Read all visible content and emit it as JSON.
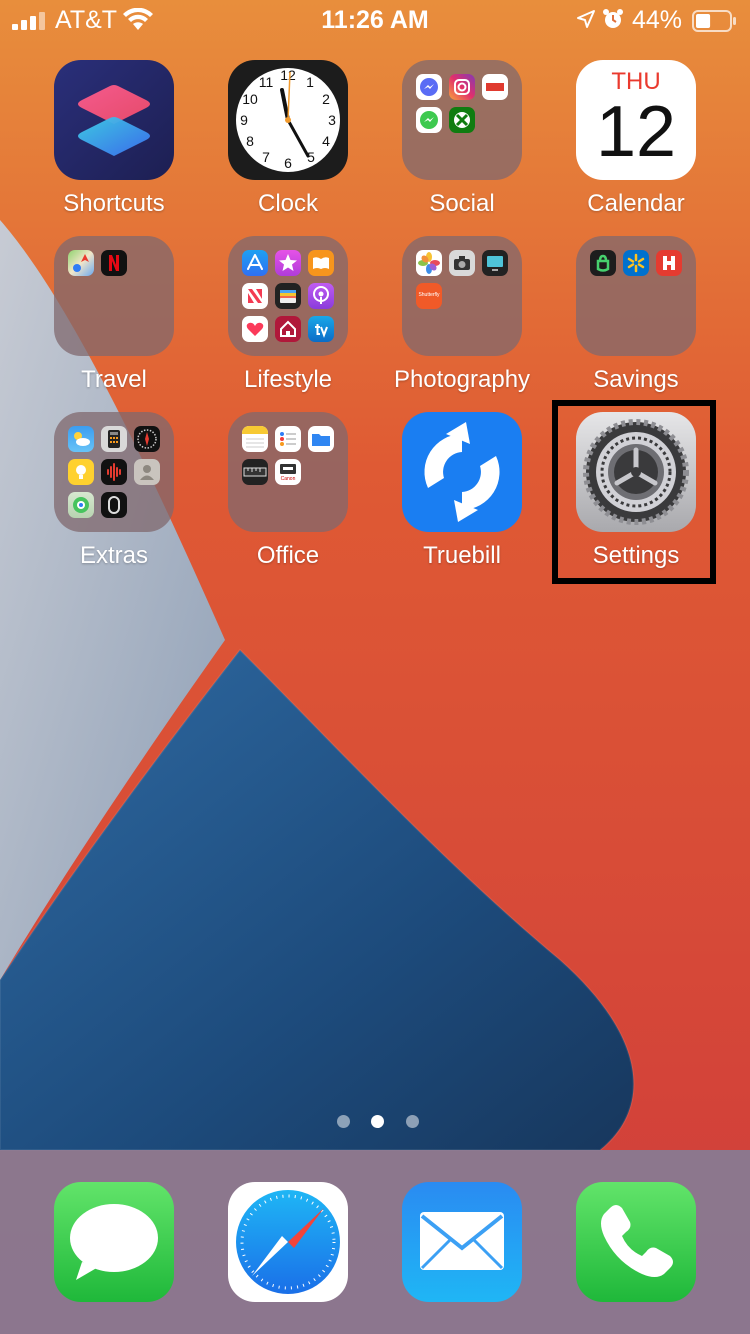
{
  "status_bar": {
    "carrier": "AT&T",
    "time": "11:26 AM",
    "battery_percent": "44%",
    "battery_level": 0.44,
    "icons": [
      "signal-icon",
      "wifi-icon",
      "location-icon",
      "alarm-icon",
      "battery-icon"
    ]
  },
  "home": {
    "rows": [
      [
        {
          "label": "Shortcuts",
          "type": "app",
          "icon": "shortcuts-icon"
        },
        {
          "label": "Clock",
          "type": "app",
          "icon": "clock-icon"
        },
        {
          "label": "Social",
          "type": "folder",
          "apps": [
            "messenger-icon",
            "instagram-icon",
            "espn-icon",
            "messenger-lite-icon",
            "xbox-icon"
          ]
        },
        {
          "label": "Calendar",
          "type": "app",
          "icon": "calendar-icon",
          "weekday": "THU",
          "day": "12"
        }
      ],
      [
        {
          "label": "Travel",
          "type": "folder",
          "apps": [
            "maps-icon",
            "netflix-icon"
          ]
        },
        {
          "label": "Lifestyle",
          "type": "folder",
          "apps": [
            "app-store-icon",
            "itunes-store-icon",
            "books-icon",
            "news-icon",
            "wallet-icon",
            "podcasts-icon",
            "health-icon",
            "home-icon",
            "tv-icon"
          ]
        },
        {
          "label": "Photography",
          "type": "folder",
          "apps": [
            "photos-icon",
            "camera-icon",
            "screen-icon",
            "shutterfly-icon"
          ],
          "shutterfly_text": "Shutterfly"
        },
        {
          "label": "Savings",
          "type": "folder",
          "apps": [
            "acorns-icon",
            "walmart-icon",
            "honey-icon"
          ]
        }
      ],
      [
        {
          "label": "Extras",
          "type": "folder",
          "apps": [
            "weather-icon",
            "calculator-icon",
            "compass-icon",
            "tips-icon",
            "voice-memos-icon",
            "contacts-icon",
            "find-my-icon",
            "watch-icon"
          ]
        },
        {
          "label": "Office",
          "type": "folder",
          "apps": [
            "notes-icon",
            "reminders-icon",
            "files-icon",
            "measure-icon",
            "canon-icon"
          ],
          "canon_text": "Canon"
        },
        {
          "label": "Truebill",
          "type": "app",
          "icon": "truebill-icon"
        },
        {
          "label": "Settings",
          "type": "app",
          "icon": "settings-icon",
          "highlighted": true
        }
      ]
    ]
  },
  "page_indicator": {
    "count": 3,
    "active": 2
  },
  "dock": [
    {
      "name": "Messages",
      "icon": "messages-icon"
    },
    {
      "name": "Safari",
      "icon": "safari-icon"
    },
    {
      "name": "Mail",
      "icon": "mail-icon"
    },
    {
      "name": "Phone",
      "icon": "phone-icon"
    }
  ],
  "colors": {
    "wallpaper_orange": "#e0703a",
    "wallpaper_red": "#d8402f",
    "wallpaper_grey": "#aab4c4",
    "wallpaper_blue": "#1f4d80",
    "highlight_border": "#000000"
  }
}
